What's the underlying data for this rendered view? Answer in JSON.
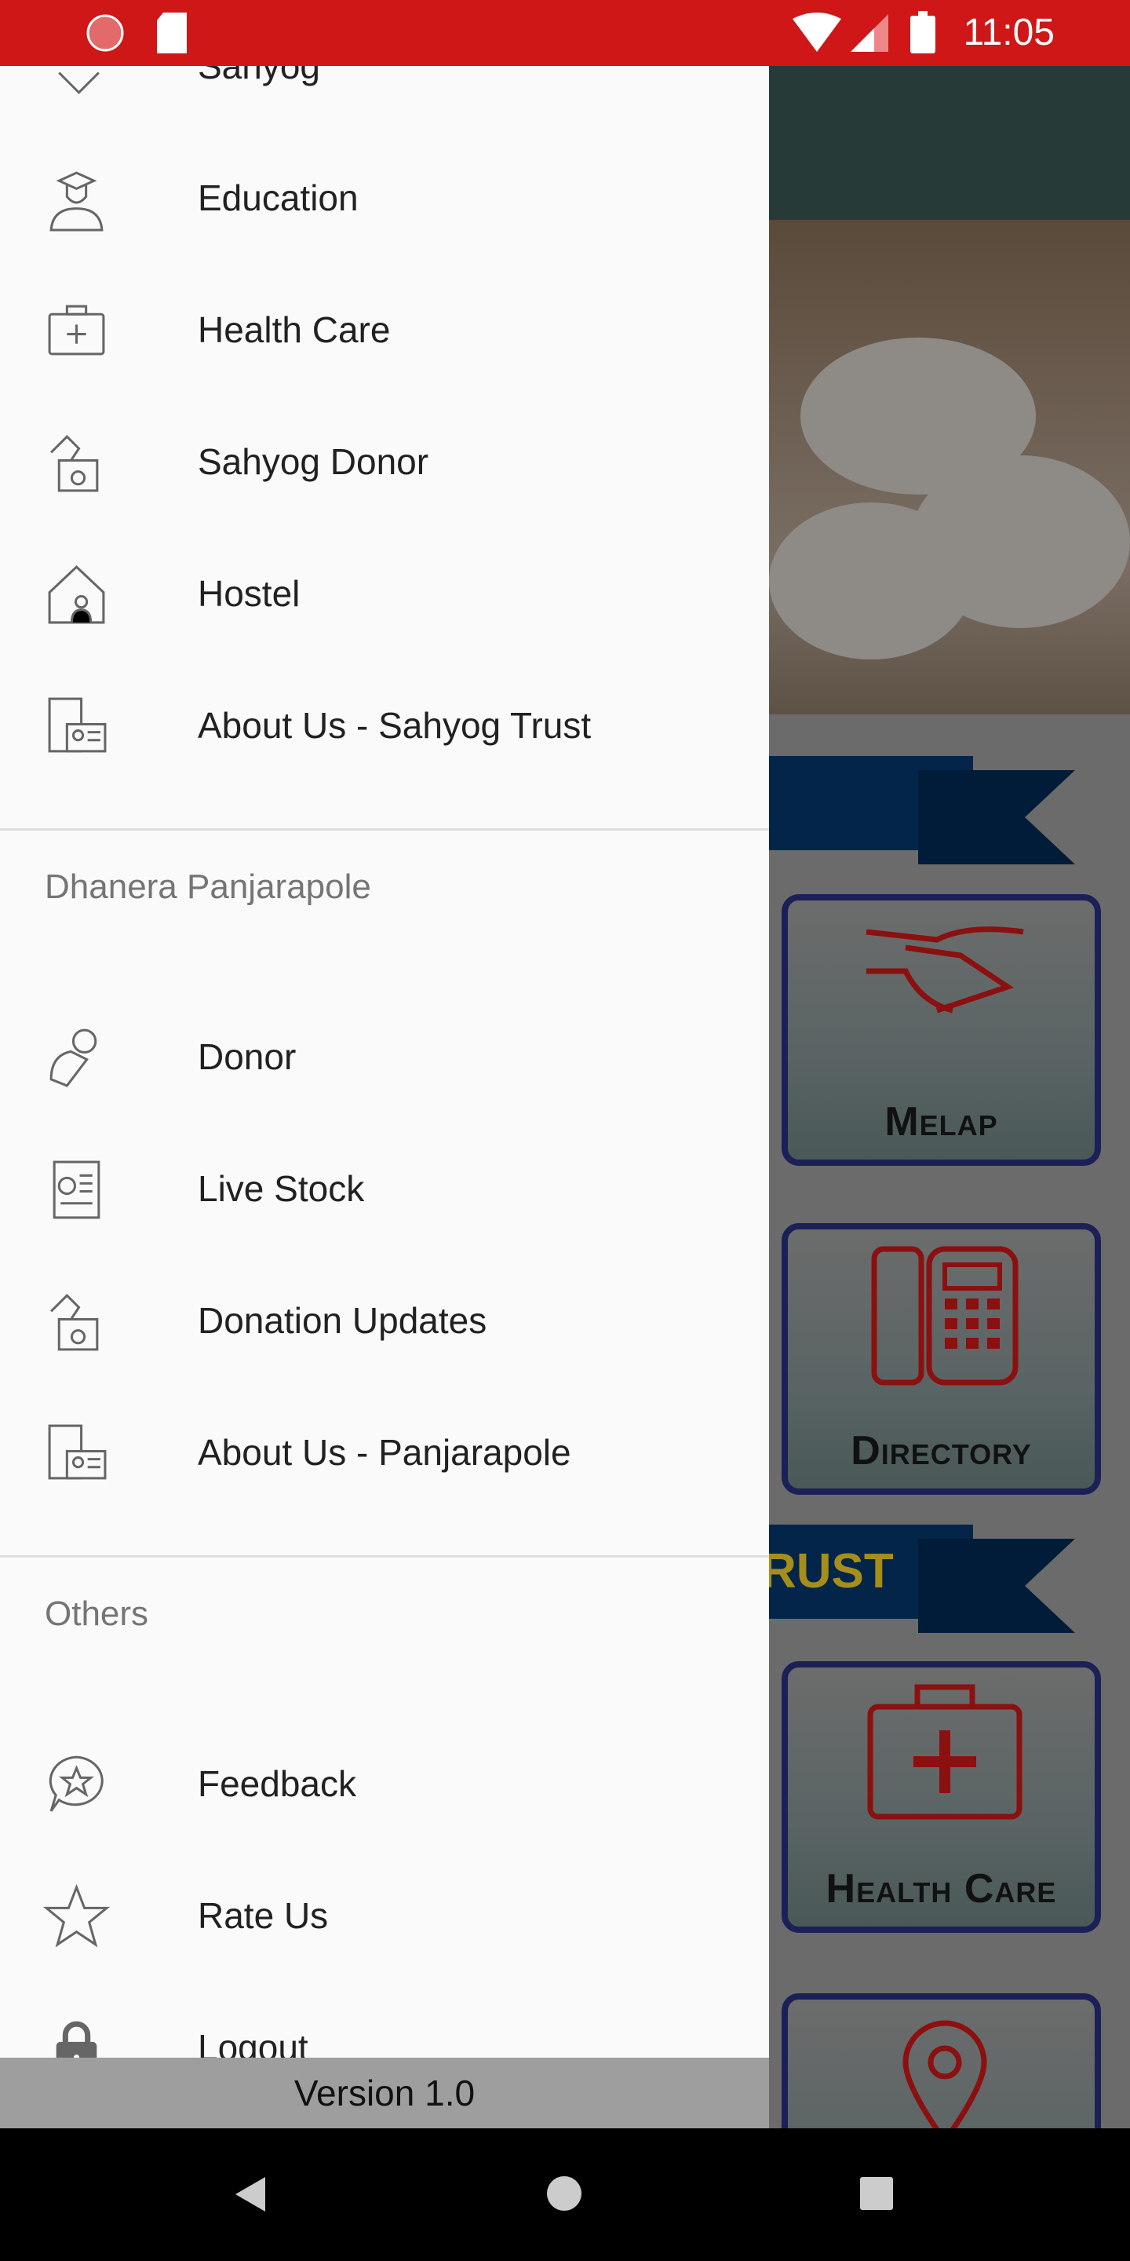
{
  "status_bar": {
    "time": "11:05",
    "color": "#cf1717"
  },
  "drawer": {
    "sections": [
      {
        "header": "",
        "items": [
          {
            "label": "Sahyog",
            "icon": "handshake-icon"
          },
          {
            "label": "Education",
            "icon": "graduate-icon"
          },
          {
            "label": "Health Care",
            "icon": "medical-kit-icon"
          },
          {
            "label": "Sahyog Donor",
            "icon": "donation-box-icon"
          },
          {
            "label": "Hostel",
            "icon": "house-icon"
          },
          {
            "label": "About Us - Sahyog Trust",
            "icon": "id-card-building-icon"
          }
        ]
      },
      {
        "header": "Dhanera Panjarapole",
        "items": [
          {
            "label": "Donor",
            "icon": "hand-coin-icon"
          },
          {
            "label": "Live Stock",
            "icon": "report-scroll-icon"
          },
          {
            "label": "Donation Updates",
            "icon": "donation-box-icon"
          },
          {
            "label": "About Us - Panjarapole",
            "icon": "id-card-building-icon"
          }
        ]
      },
      {
        "header": "Others",
        "items": [
          {
            "label": "Feedback",
            "icon": "chat-star-icon"
          },
          {
            "label": "Rate Us",
            "icon": "star-icon"
          },
          {
            "label": "Logout",
            "icon": "lock-icon"
          }
        ]
      }
    ],
    "version": "Version 1.0"
  },
  "background": {
    "ribbon2_text": "RUST",
    "cards": [
      "Melap",
      "Directory",
      "Health Care"
    ]
  }
}
